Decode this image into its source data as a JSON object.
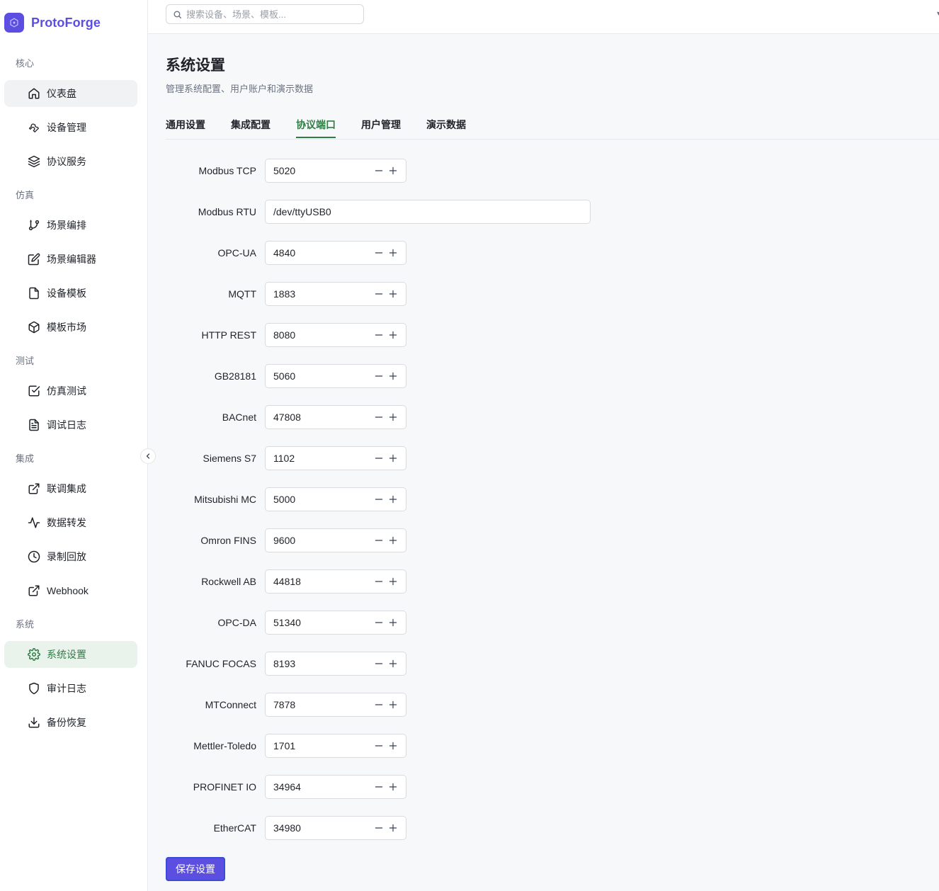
{
  "brand": {
    "name": "ProtoForge"
  },
  "search": {
    "placeholder": "搜索设备、场景、模板..."
  },
  "sidebar": {
    "sections": [
      {
        "label": "核心"
      },
      {
        "label": "仿真"
      },
      {
        "label": "测试"
      },
      {
        "label": "集成"
      },
      {
        "label": "系统"
      }
    ],
    "items": [
      {
        "label": "仪表盘",
        "icon": "home-icon"
      },
      {
        "label": "设备管理",
        "icon": "wrench-icon"
      },
      {
        "label": "协议服务",
        "icon": "layers-icon"
      },
      {
        "label": "场景编排",
        "icon": "git-branch-icon"
      },
      {
        "label": "场景编辑器",
        "icon": "edit-icon"
      },
      {
        "label": "设备模板",
        "icon": "file-icon"
      },
      {
        "label": "模板市场",
        "icon": "package-icon"
      },
      {
        "label": "仿真测试",
        "icon": "check-square-icon"
      },
      {
        "label": "调试日志",
        "icon": "file-text-icon"
      },
      {
        "label": "联调集成",
        "icon": "external-link-icon"
      },
      {
        "label": "数据转发",
        "icon": "activity-icon"
      },
      {
        "label": "录制回放",
        "icon": "clock-icon"
      },
      {
        "label": "Webhook",
        "icon": "external-link-icon"
      },
      {
        "label": "系统设置",
        "icon": "settings-icon"
      },
      {
        "label": "审计日志",
        "icon": "shield-icon"
      },
      {
        "label": "备份恢复",
        "icon": "download-icon"
      }
    ]
  },
  "page": {
    "title": "系统设置",
    "subtitle": "管理系统配置、用户账户和演示数据"
  },
  "tabs": [
    {
      "label": "通用设置"
    },
    {
      "label": "集成配置"
    },
    {
      "label": "协议端口"
    },
    {
      "label": "用户管理"
    },
    {
      "label": "演示数据"
    }
  ],
  "active_tab": "协议端口",
  "ports": [
    {
      "label": "Modbus TCP",
      "value": "5020"
    },
    {
      "label": "Modbus RTU",
      "value": "/dev/ttyUSB0"
    },
    {
      "label": "OPC-UA",
      "value": "4840"
    },
    {
      "label": "MQTT",
      "value": "1883"
    },
    {
      "label": "HTTP REST",
      "value": "8080"
    },
    {
      "label": "GB28181",
      "value": "5060"
    },
    {
      "label": "BACnet",
      "value": "47808"
    },
    {
      "label": "Siemens S7",
      "value": "1102"
    },
    {
      "label": "Mitsubishi MC",
      "value": "5000"
    },
    {
      "label": "Omron FINS",
      "value": "9600"
    },
    {
      "label": "Rockwell AB",
      "value": "44818"
    },
    {
      "label": "OPC-DA",
      "value": "51340"
    },
    {
      "label": "FANUC FOCAS",
      "value": "8193"
    },
    {
      "label": "MTConnect",
      "value": "7878"
    },
    {
      "label": "Mettler-Toledo",
      "value": "1701"
    },
    {
      "label": "PROFINET IO",
      "value": "34964"
    },
    {
      "label": "EtherCAT",
      "value": "34980"
    }
  ],
  "actions": {
    "save_label": "保存设置"
  },
  "colors": {
    "accent": "#5b4ee0",
    "active_green": "#2e7d45",
    "active_green_bg": "#eaf2ec"
  }
}
